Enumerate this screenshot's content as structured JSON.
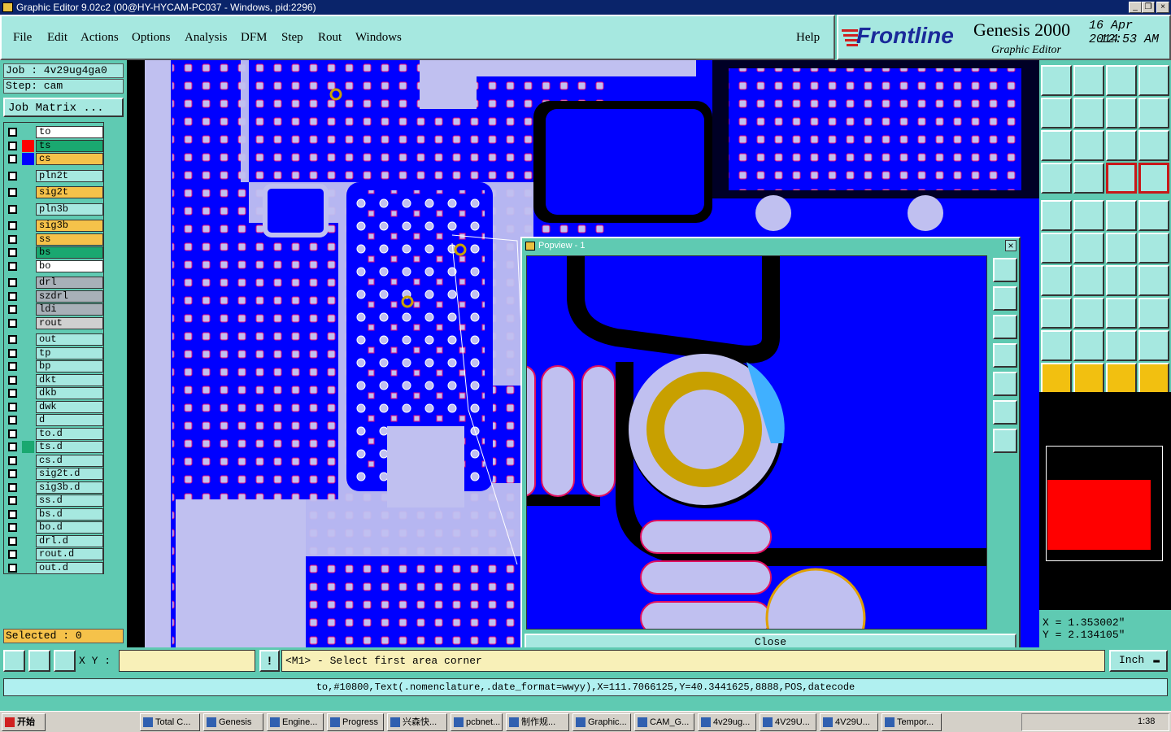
{
  "window": {
    "title": "Graphic Editor 9.02c2 (00@HY-HYCAM-PC037 - Windows, pid:2296)"
  },
  "menu": {
    "file": "File",
    "edit": "Edit",
    "actions": "Actions",
    "options": "Options",
    "analysis": "Analysis",
    "dfm": "DFM",
    "step": "Step",
    "rout": "Rout",
    "windows": "Windows",
    "help": "Help"
  },
  "brand": {
    "logo": "Frontline",
    "product": "Genesis 2000",
    "subtitle": "Graphic Editor",
    "date": "16 Apr 2014",
    "time": "12:53 AM"
  },
  "job": {
    "job": "Job : 4v29ug4ga0",
    "step": "Step: cam",
    "matrix": "Job Matrix ...",
    "selected": "Selected : 0"
  },
  "layers": [
    {
      "name": "to",
      "bg": "#ffffff",
      "sw": "",
      "mark": "◆"
    },
    {
      "name": "ts",
      "bg": "#1aa870",
      "sw": "#ff0000",
      "mark": "□"
    },
    {
      "name": "cs",
      "bg": "#f5c24a",
      "sw": "#0000ff",
      "mark": ""
    },
    {
      "name": "pln2t",
      "bg": "#a6e8e0",
      "sw": "",
      "mark": ""
    },
    {
      "name": "sig2t",
      "bg": "#f5c24a",
      "sw": "",
      "mark": ""
    },
    {
      "name": "pln3b",
      "bg": "#a6e8e0",
      "sw": "",
      "mark": ""
    },
    {
      "name": "sig3b",
      "bg": "#f5c24a",
      "sw": "",
      "mark": ""
    },
    {
      "name": "ss",
      "bg": "#f5c24a",
      "sw": "",
      "mark": ""
    },
    {
      "name": "bs",
      "bg": "#1aa870",
      "sw": "",
      "mark": ""
    },
    {
      "name": "bo",
      "bg": "#ffffff",
      "sw": "",
      "mark": ""
    },
    {
      "name": "drl",
      "bg": "#a8b0b8",
      "sw": "",
      "mark": ""
    },
    {
      "name": "szdrl",
      "bg": "#a8b0b8",
      "sw": "",
      "mark": ""
    },
    {
      "name": "ldi",
      "bg": "#a8b0b8",
      "sw": "",
      "mark": ""
    },
    {
      "name": "rout",
      "bg": "#d0d0d0",
      "sw": "",
      "mark": ""
    },
    {
      "name": "out",
      "bg": "#a6e8e0",
      "sw": "",
      "mark": ""
    },
    {
      "name": "tp",
      "bg": "#a6e8e0",
      "sw": "",
      "mark": ""
    },
    {
      "name": "bp",
      "bg": "#a6e8e0",
      "sw": "",
      "mark": ""
    },
    {
      "name": "dkt",
      "bg": "#a6e8e0",
      "sw": "",
      "mark": ""
    },
    {
      "name": "dkb",
      "bg": "#a6e8e0",
      "sw": "",
      "mark": ""
    },
    {
      "name": "dwk",
      "bg": "#a6e8e0",
      "sw": "",
      "mark": ""
    },
    {
      "name": "d",
      "bg": "#a6e8e0",
      "sw": "",
      "mark": ""
    },
    {
      "name": "to.d",
      "bg": "#a6e8e0",
      "sw": "",
      "mark": "◆"
    },
    {
      "name": "ts.d",
      "bg": "#a6e8e0",
      "sw": "#1aa870",
      "mark": ""
    },
    {
      "name": "cs.d",
      "bg": "#a6e8e0",
      "sw": "",
      "mark": ""
    },
    {
      "name": "sig2t.d",
      "bg": "#a6e8e0",
      "sw": "",
      "mark": ""
    },
    {
      "name": "sig3b.d",
      "bg": "#a6e8e0",
      "sw": "",
      "mark": ""
    },
    {
      "name": "ss.d",
      "bg": "#a6e8e0",
      "sw": "",
      "mark": ""
    },
    {
      "name": "bs.d",
      "bg": "#a6e8e0",
      "sw": "",
      "mark": ""
    },
    {
      "name": "bo.d",
      "bg": "#a6e8e0",
      "sw": "",
      "mark": ""
    },
    {
      "name": "drl.d",
      "bg": "#a6e8e0",
      "sw": "",
      "mark": ""
    },
    {
      "name": "rout.d",
      "bg": "#a6e8e0",
      "sw": "",
      "mark": ""
    },
    {
      "name": "out.d",
      "bg": "#a6e8e0",
      "sw": "",
      "mark": ""
    }
  ],
  "popview": {
    "title": "Popview - 1",
    "close": "Close"
  },
  "coords": {
    "x": "X = 1.353002\"",
    "y": "Y = 2.134105\""
  },
  "input": {
    "xy_label": "X Y :",
    "units": "Inch",
    "prompt": "<M1> - Select first area corner",
    "excl": "!"
  },
  "status": {
    "text": "to,#10800,Text(.nomenclature,.date_format=wwyy),X=111.7066125,Y=40.3441625,8888,POS,datecode"
  },
  "taskbar": {
    "start": "开始",
    "clock": "1:38",
    "tasks": [
      "Total C...",
      "Genesis",
      "Engine...",
      "Progress",
      "兴森快...",
      "pcbnet...",
      "制作规...",
      "Graphic...",
      "CAM_G...",
      "4v29ug...",
      "4V29U...",
      "4V29U...",
      "Tempor..."
    ]
  },
  "colors": {
    "bg": "#5fcab2",
    "canvas": "#0000ff",
    "pad": "#c0c0f0",
    "gold": "#c8a000"
  }
}
